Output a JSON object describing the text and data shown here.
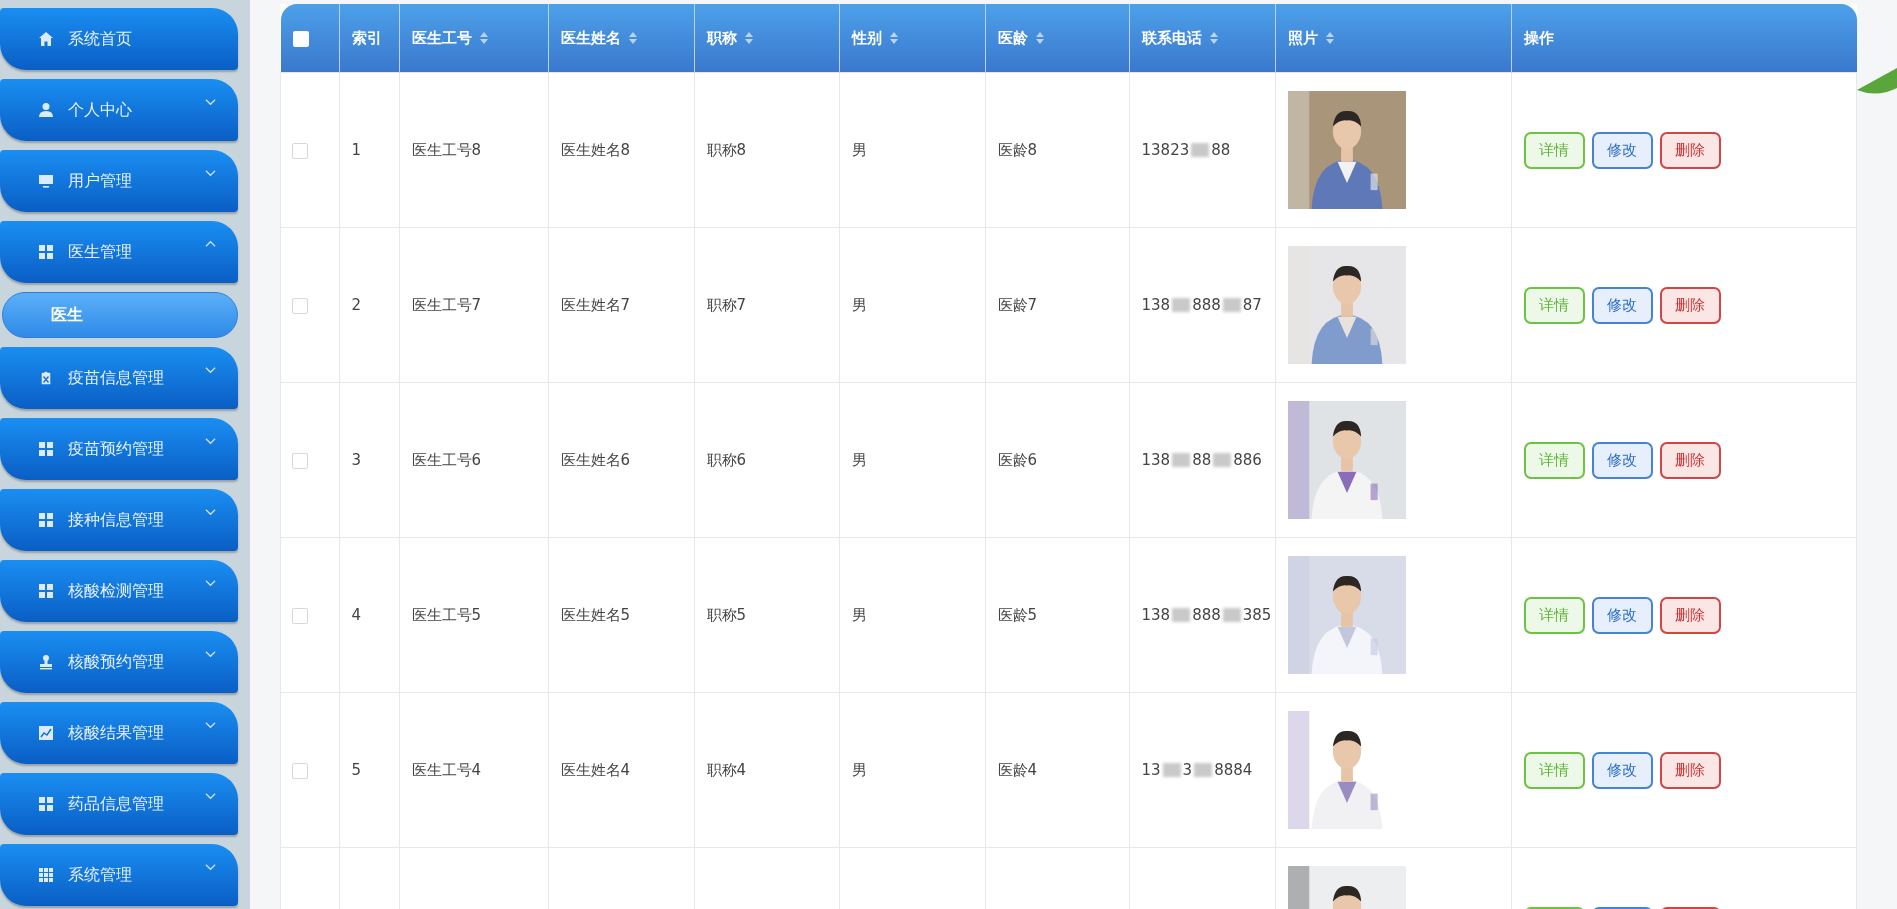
{
  "sidebar": {
    "items": [
      {
        "label": "系统首页",
        "kind": "home"
      },
      {
        "label": "个人中心",
        "kind": "user",
        "expanded": false
      },
      {
        "label": "用户管理",
        "kind": "monitor",
        "expanded": false
      },
      {
        "label": "医生管理",
        "kind": "grid",
        "expanded": true,
        "children": [
          {
            "label": "医生",
            "selected": true
          }
        ]
      },
      {
        "label": "疫苗信息管理",
        "kind": "clipboard",
        "expanded": false
      },
      {
        "label": "疫苗预约管理",
        "kind": "grid",
        "expanded": false
      },
      {
        "label": "接种信息管理",
        "kind": "grid",
        "expanded": false
      },
      {
        "label": "核酸检测管理",
        "kind": "grid",
        "expanded": false
      },
      {
        "label": "核酸预约管理",
        "kind": "stamp",
        "expanded": false
      },
      {
        "label": "核酸结果管理",
        "kind": "chart",
        "expanded": false
      },
      {
        "label": "药品信息管理",
        "kind": "grid",
        "expanded": false
      },
      {
        "label": "系统管理",
        "kind": "apps",
        "expanded": false
      }
    ]
  },
  "table": {
    "select_all": {
      "checked": false
    },
    "columns": [
      {
        "label": "索引",
        "sortable": false
      },
      {
        "label": "医生工号",
        "sortable": true
      },
      {
        "label": "医生姓名",
        "sortable": true
      },
      {
        "label": "职称",
        "sortable": true
      },
      {
        "label": "性别",
        "sortable": true
      },
      {
        "label": "医龄",
        "sortable": true
      },
      {
        "label": "联系电话",
        "sortable": true
      },
      {
        "label": "照片",
        "sortable": true
      },
      {
        "label": "操作",
        "sortable": false
      }
    ],
    "rows": [
      {
        "checked": false,
        "index": "1",
        "doctor_id": "医生工号8",
        "doctor_name": "医生姓名8",
        "title": "职称8",
        "gender": "男",
        "seniority": "医龄8",
        "phone_parts": [
          "13823",
          "88"
        ],
        "photo": {
          "kind": "picture"
        },
        "actions": [
          {
            "kind": "detail",
            "label": "详情"
          },
          {
            "kind": "edit",
            "label": "修改"
          },
          {
            "kind": "delete",
            "label": "删除"
          }
        ]
      },
      {
        "checked": false,
        "index": "2",
        "doctor_id": "医生工号7",
        "doctor_name": "医生姓名7",
        "title": "职称7",
        "gender": "男",
        "seniority": "医龄7",
        "phone_parts": [
          "138",
          "888",
          "87"
        ],
        "photo": {
          "kind": "picture"
        },
        "actions": [
          {
            "kind": "detail",
            "label": "详情"
          },
          {
            "kind": "edit",
            "label": "修改"
          },
          {
            "kind": "delete",
            "label": "删除"
          }
        ]
      },
      {
        "checked": false,
        "index": "3",
        "doctor_id": "医生工号6",
        "doctor_name": "医生姓名6",
        "title": "职称6",
        "gender": "男",
        "seniority": "医龄6",
        "phone_parts": [
          "138",
          "88",
          "886"
        ],
        "photo": {
          "kind": "picture"
        },
        "actions": [
          {
            "kind": "detail",
            "label": "详情"
          },
          {
            "kind": "edit",
            "label": "修改"
          },
          {
            "kind": "delete",
            "label": "删除"
          }
        ]
      },
      {
        "checked": false,
        "index": "4",
        "doctor_id": "医生工号5",
        "doctor_name": "医生姓名5",
        "title": "职称5",
        "gender": "男",
        "seniority": "医龄5",
        "phone_parts": [
          "138",
          "888",
          "385"
        ],
        "photo": {
          "kind": "picture"
        },
        "actions": [
          {
            "kind": "detail",
            "label": "详情"
          },
          {
            "kind": "edit",
            "label": "修改"
          },
          {
            "kind": "delete",
            "label": "删除"
          }
        ]
      },
      {
        "checked": false,
        "index": "5",
        "doctor_id": "医生工号4",
        "doctor_name": "医生姓名4",
        "title": "职称4",
        "gender": "男",
        "seniority": "医龄4",
        "phone_parts": [
          "13",
          "3",
          "8884"
        ],
        "photo": {
          "kind": "picture"
        },
        "actions": [
          {
            "kind": "detail",
            "label": "详情"
          },
          {
            "kind": "edit",
            "label": "修改"
          },
          {
            "kind": "delete",
            "label": "删除"
          }
        ]
      },
      {
        "photo": {
          "kind": "picture"
        },
        "actions": [
          {
            "kind": "detail"
          },
          {
            "kind": "edit"
          },
          {
            "kind": "delete"
          }
        ]
      }
    ]
  }
}
